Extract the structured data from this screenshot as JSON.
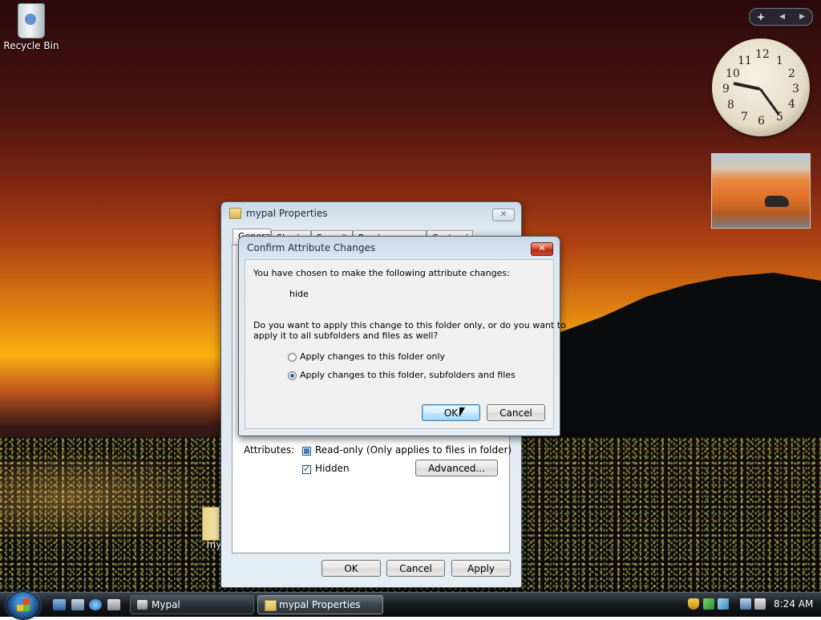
{
  "desktop": {
    "recycle_bin_label": "Recycle Bin",
    "folder_label": "my"
  },
  "gadgets": {
    "add_symbol": "+",
    "prev_symbol": "◀",
    "next_symbol": "▶",
    "clock": {
      "numbers": [
        "12",
        "1",
        "2",
        "3",
        "4",
        "5",
        "6",
        "7",
        "8",
        "9",
        "10",
        "11"
      ],
      "shown_time": "8:24"
    }
  },
  "properties_window": {
    "title": "mypal Properties",
    "tabs": [
      "General",
      "Sharing",
      "Security",
      "Previous Versions",
      "Customize"
    ],
    "attributes_label": "Attributes:",
    "readonly_label": "Read-only (Only applies to files in folder)",
    "hidden_label": "Hidden",
    "advanced_button": "Advanced...",
    "ok_button": "OK",
    "cancel_button": "Cancel",
    "apply_button": "Apply",
    "readonly_state": "partial",
    "hidden_checked": true
  },
  "confirm_dialog": {
    "title": "Confirm Attribute Changes",
    "intro_text": "You have chosen to make the following attribute changes:",
    "change_item": "hide",
    "question_line1": "Do you want to apply this change to this folder only, or do you want to",
    "question_line2": "apply it to all subfolders and files as well?",
    "option_folder_only": "Apply changes to this folder only",
    "option_all": "Apply changes to this folder, subfolders and files",
    "selected_option": "option_all",
    "ok_button": "OK",
    "cancel_button": "Cancel",
    "close_symbol": "✕"
  },
  "taskbar": {
    "buttons": [
      "Mypal",
      "mypal Properties"
    ],
    "clock": "8:24 AM"
  },
  "colors": {
    "dialog_close": "#c9482f",
    "default_button": "#bee6fd",
    "taskbar": "#15191d"
  }
}
